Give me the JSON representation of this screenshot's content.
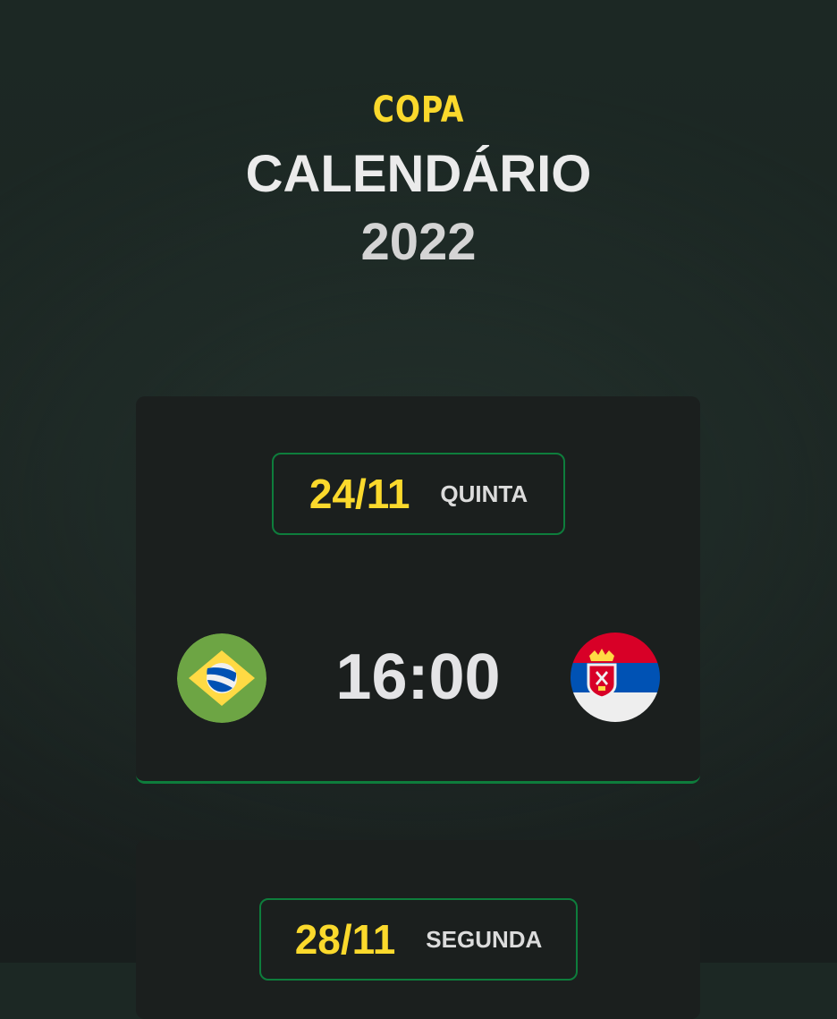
{
  "header": {
    "brand": "COPA",
    "title": "CALENDÁRIO",
    "year": "2022"
  },
  "matches": [
    {
      "date": "24/11",
      "weekday": "QUINTA",
      "time": "16:00",
      "home_flag": "brazil-flag-icon",
      "away_flag": "serbia-flag-icon"
    },
    {
      "date": "28/11",
      "weekday": "SEGUNDA"
    }
  ],
  "colors": {
    "accent_yellow": "#fbd92c",
    "accent_green": "#0e7d3c",
    "card_bg": "#1b1f1e",
    "text_light": "#ebebeb"
  }
}
